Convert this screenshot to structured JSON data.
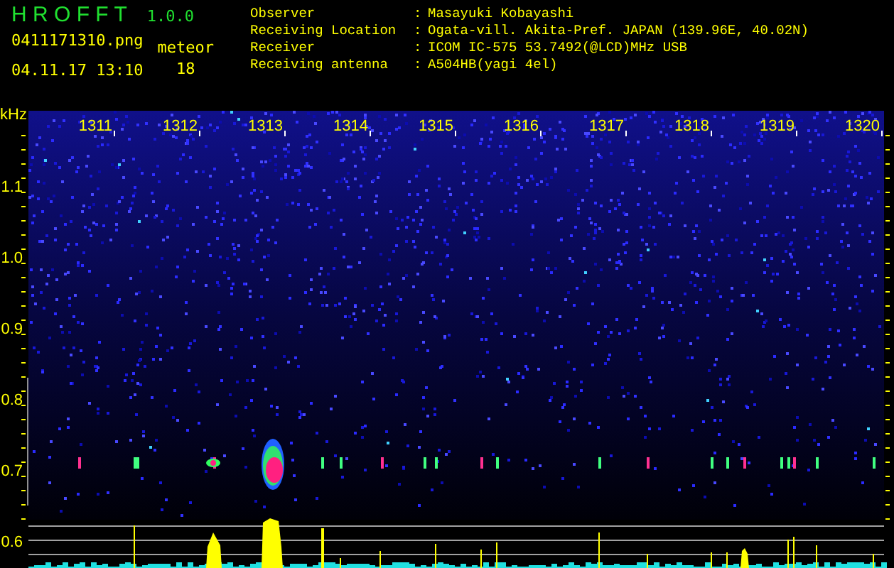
{
  "header": {
    "app_name": "H R O F F T",
    "version": "1.0.0",
    "file_name": "0411171310.png",
    "timestamp": "04.11.17 13:10",
    "meteor_label": "meteor",
    "meteor_count": "18"
  },
  "info": [
    {
      "label": "Observer",
      "separator": ":",
      "value": "Masayuki Kobayashi"
    },
    {
      "label": "Receiving Location",
      "separator": ":",
      "value": "Ogata-vill. Akita-Pref. JAPAN (139.96E, 40.02N)"
    },
    {
      "label": "Receiver",
      "separator": ":",
      "value": "ICOM IC-575 53.7492(@LCD)MHz USB"
    },
    {
      "label": "Receiving antenna",
      "separator": ":",
      "value": "A504HB(yagi 4el)"
    }
  ],
  "spectrogram": {
    "y_unit": "kHz",
    "y_ticks": [
      "1.1",
      "1.0",
      "0.9",
      "0.8",
      "0.7",
      "0.6"
    ],
    "x_ticks": [
      "1311",
      "1312",
      "1313",
      "1314",
      "1315",
      "1316",
      "1317",
      "1318",
      "1319",
      "1320"
    ]
  }
}
